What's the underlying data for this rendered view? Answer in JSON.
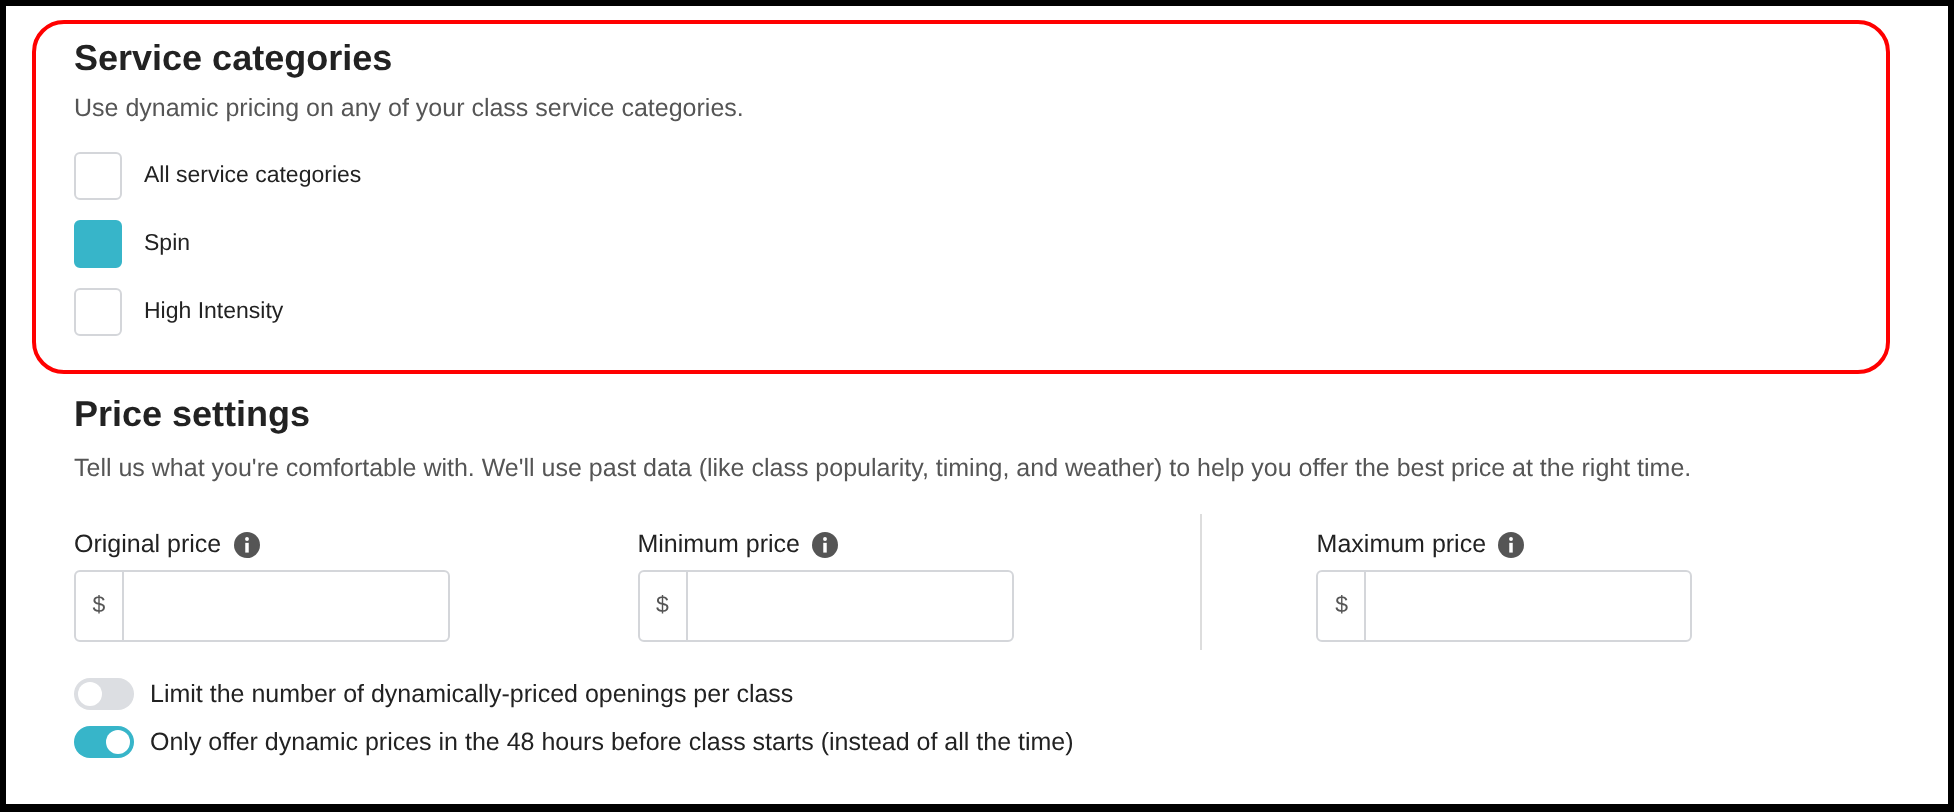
{
  "service_categories": {
    "title": "Service categories",
    "description": "Use dynamic pricing on any of your class service categories.",
    "options": [
      {
        "label": "All service categories",
        "checked": false
      },
      {
        "label": "Spin",
        "checked": true
      },
      {
        "label": "High Intensity",
        "checked": false
      }
    ]
  },
  "price_settings": {
    "title": "Price settings",
    "description": "Tell us what you're comfortable with. We'll use past data (like class popularity, timing, and weather) to help you offer the best price at the right time.",
    "fields": [
      {
        "label": "Original price",
        "prefix": "$"
      },
      {
        "label": "Minimum price",
        "prefix": "$"
      },
      {
        "label": "Maximum price",
        "prefix": "$"
      }
    ],
    "toggles": [
      {
        "label": "Limit the number of dynamically-priced openings per class",
        "on": false
      },
      {
        "label": "Only offer dynamic prices in the 48 hours before class starts (instead of all the time)",
        "on": true
      }
    ]
  }
}
